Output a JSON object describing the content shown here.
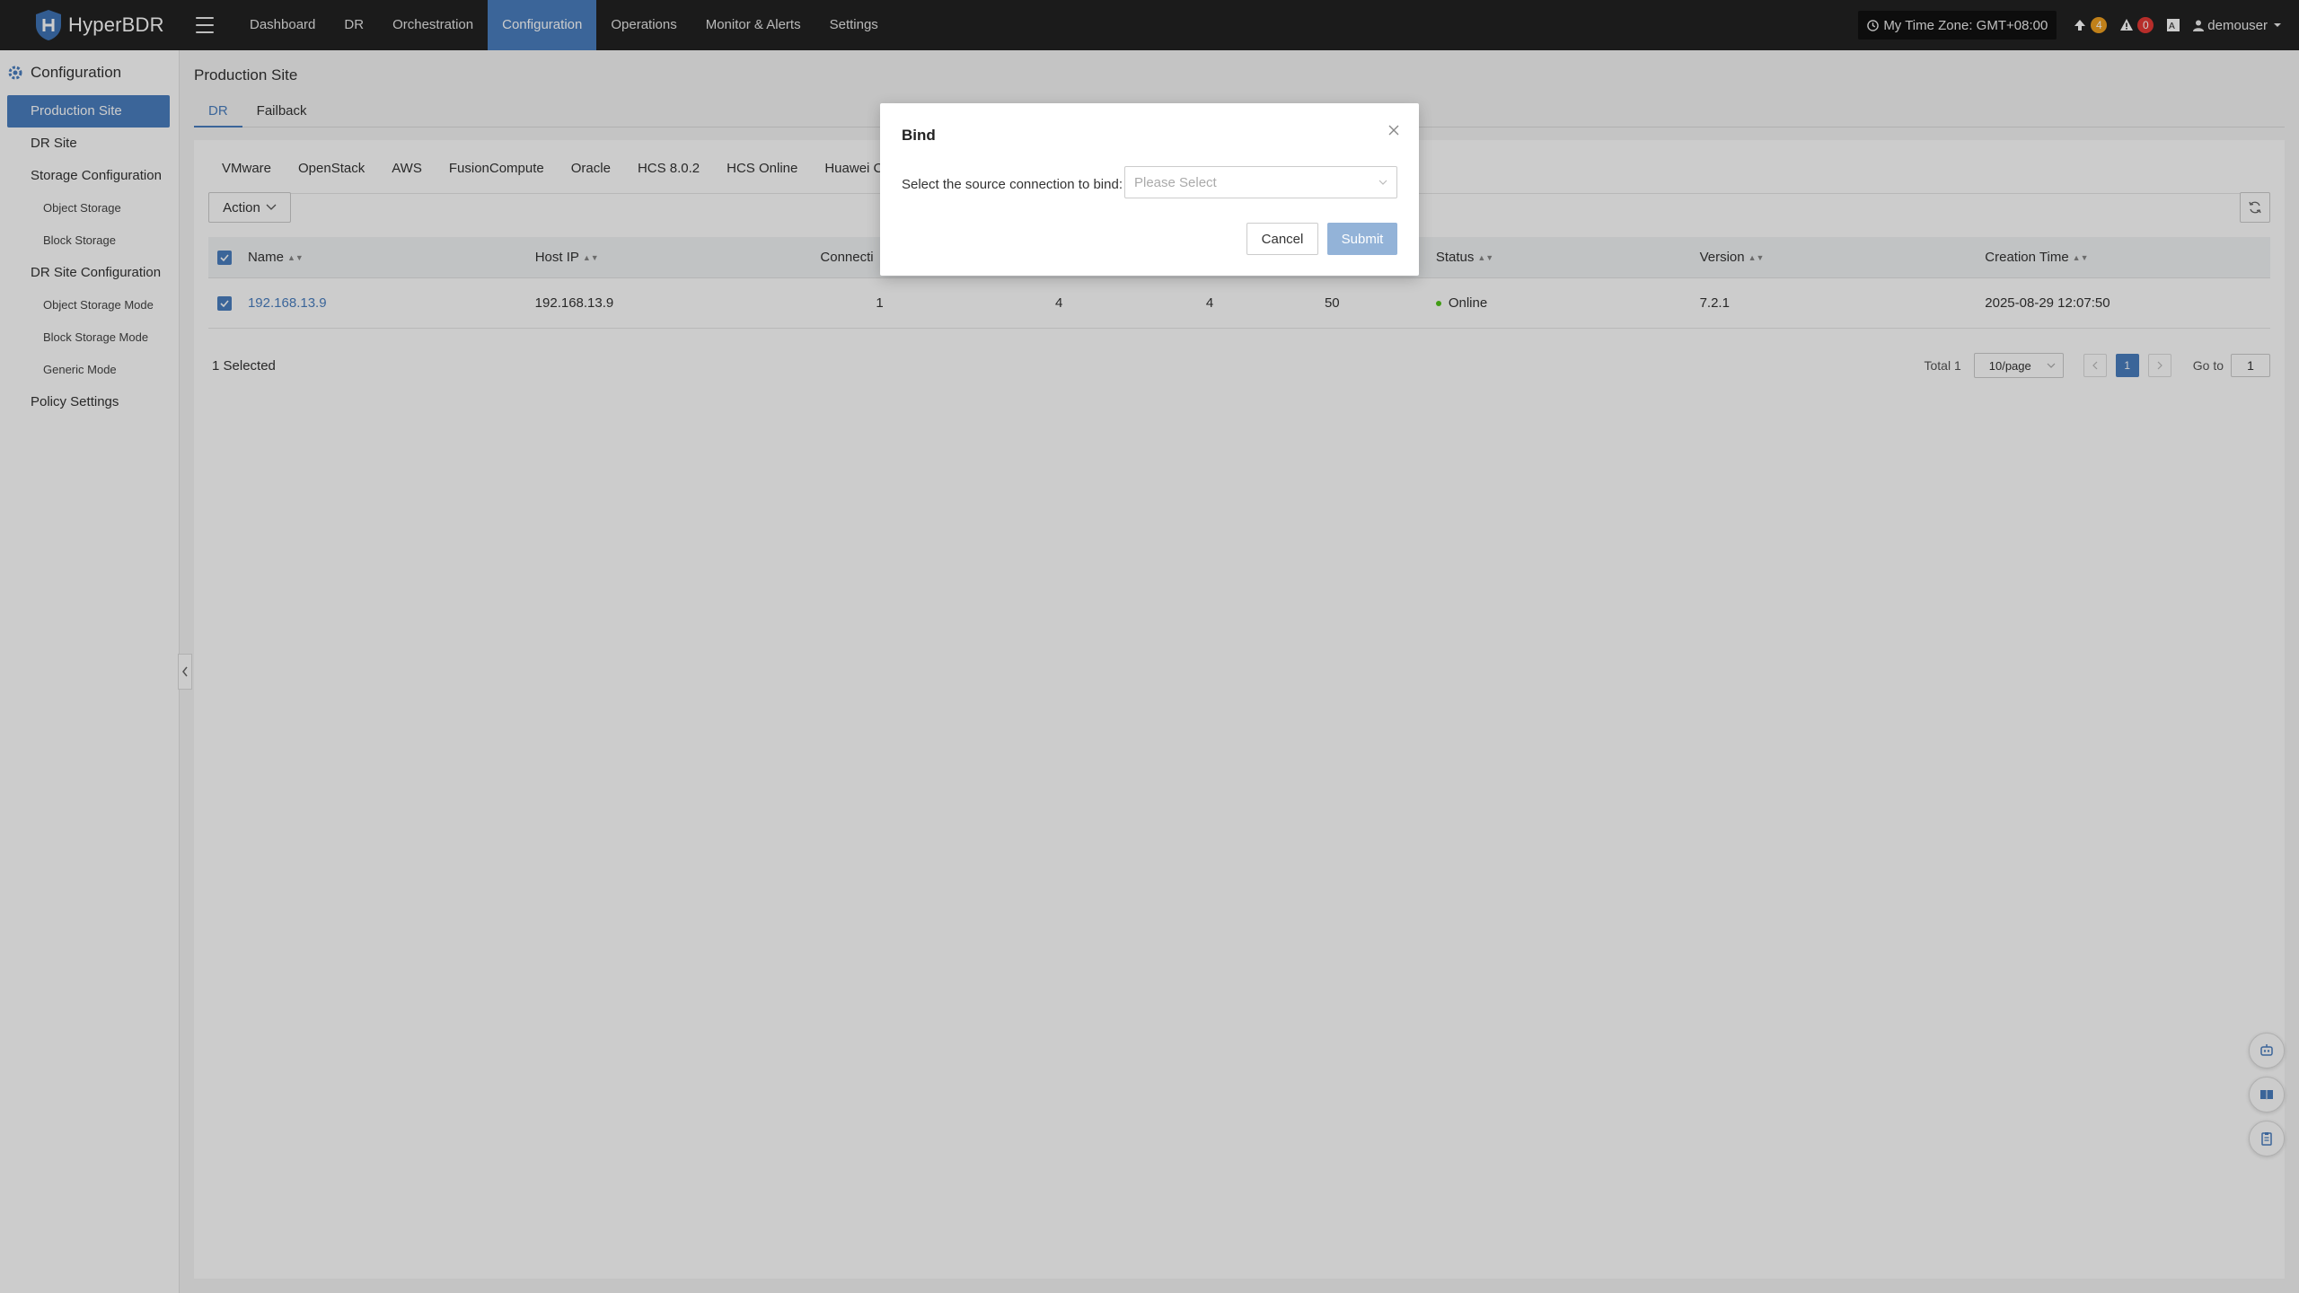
{
  "app": {
    "name": "HyperBDR"
  },
  "topnav": {
    "items": [
      {
        "label": "Dashboard"
      },
      {
        "label": "DR"
      },
      {
        "label": "Orchestration"
      },
      {
        "label": "Configuration",
        "active": true
      },
      {
        "label": "Operations"
      },
      {
        "label": "Monitor & Alerts"
      },
      {
        "label": "Settings"
      }
    ],
    "timezone": "My Time Zone: GMT+08:00",
    "upgrade_count": "4",
    "alert_count": "0",
    "user": "demouser"
  },
  "sidebar": {
    "header": "Configuration",
    "items": [
      {
        "label": "Production Site"
      },
      {
        "label": "DR Site"
      },
      {
        "label": "Storage Configuration"
      },
      {
        "label": "Object Storage"
      },
      {
        "label": "Block Storage"
      },
      {
        "label": "DR Site Configuration"
      },
      {
        "label": "Object Storage Mode"
      },
      {
        "label": "Block Storage Mode"
      },
      {
        "label": "Generic Mode"
      },
      {
        "label": "Policy Settings"
      }
    ]
  },
  "main": {
    "title": "Production Site",
    "subtabs": [
      "DR",
      "Failback"
    ],
    "platform_tabs": [
      "VMware",
      "OpenStack",
      "AWS",
      "FusionCompute",
      "Oracle",
      "HCS 8.0.2",
      "HCS Online",
      "Huawei Clo"
    ],
    "action_label": "Action",
    "table": {
      "headers": {
        "name": "Name",
        "host_ip": "Host IP",
        "connection": "Connecti",
        "status": "Status",
        "version": "Version",
        "creation_time": "Creation Time"
      },
      "rows": [
        {
          "name": "192.168.13.9",
          "host_ip": "192.168.13.9",
          "connection": "1",
          "col_a": "4",
          "col_b": "4",
          "col_c": "50",
          "status": "Online",
          "version": "7.2.1",
          "creation_time": "2025-08-29 12:07:50"
        }
      ]
    },
    "selected_text": "1 Selected",
    "pagination": {
      "total": "Total 1",
      "page_size": "10/page",
      "current_page": "1",
      "goto_label": "Go to",
      "goto_value": "1"
    }
  },
  "modal": {
    "title": "Bind",
    "label": "Select the source connection to bind:",
    "placeholder": "Please Select",
    "cancel": "Cancel",
    "submit": "Submit"
  },
  "colors": {
    "accent": "#4a7fc0",
    "topbar": "#222222",
    "online": "#52c41a",
    "badge_orange": "#f0a020",
    "badge_red": "#e53935"
  }
}
